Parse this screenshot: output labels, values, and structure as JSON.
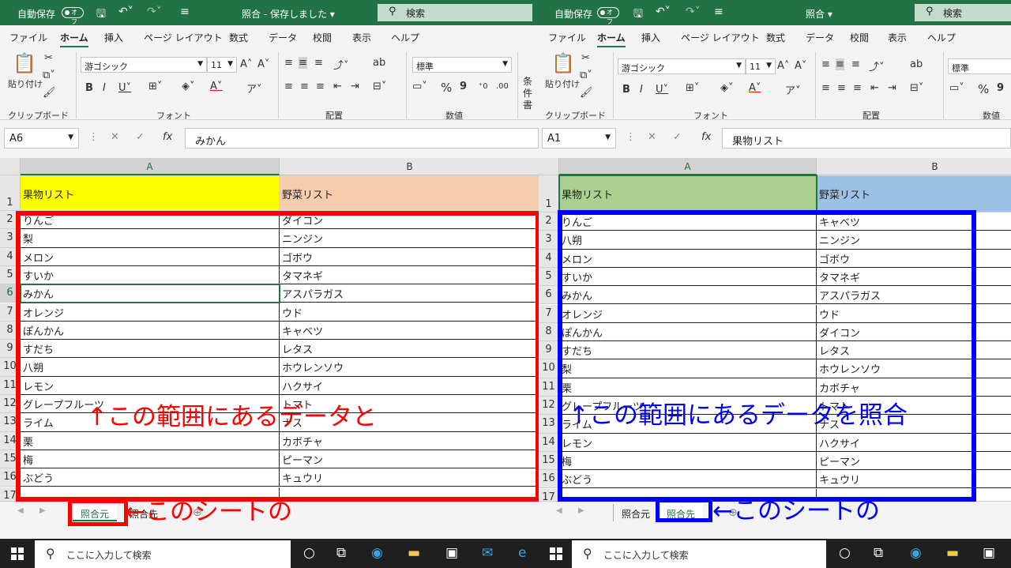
{
  "left": {
    "title": {
      "autosave": "自動保存",
      "toggle": "オフ",
      "doc": "照合 - 保存しました ▾",
      "search": "検索"
    },
    "menu": [
      "ファイル",
      "ホーム",
      "挿入",
      "ページ レイアウト",
      "数式",
      "データ",
      "校閲",
      "表示",
      "ヘルプ"
    ],
    "ribbon": {
      "paste_label": "貼り付け",
      "font_name": "游ゴシック",
      "font_size": "11",
      "number_format": "標準",
      "groups": {
        "clipboard": "クリップボード",
        "font": "フォント",
        "alignment": "配置",
        "number": "数値"
      },
      "cond_format": "条件\n書"
    },
    "name_box": "A6",
    "formula": "みかん",
    "columns": [
      "A",
      "B"
    ],
    "header_row": {
      "a": "果物リスト",
      "b": "野菜リスト"
    },
    "header_colors": {
      "a": "#ffff00",
      "b": "#f8cbad"
    },
    "rows": [
      {
        "n": "2",
        "a": "りんご",
        "b": "ダイコン"
      },
      {
        "n": "3",
        "a": "梨",
        "b": "ニンジン"
      },
      {
        "n": "4",
        "a": "メロン",
        "b": "ゴボウ"
      },
      {
        "n": "5",
        "a": "すいか",
        "b": "タマネギ"
      },
      {
        "n": "6",
        "a": "みかん",
        "b": "アスパラガス"
      },
      {
        "n": "7",
        "a": "オレンジ",
        "b": "ウド"
      },
      {
        "n": "8",
        "a": "ぽんかん",
        "b": "キャベツ"
      },
      {
        "n": "9",
        "a": "すだち",
        "b": "レタス"
      },
      {
        "n": "10",
        "a": "八朔",
        "b": "ホウレンソウ"
      },
      {
        "n": "11",
        "a": "レモン",
        "b": "ハクサイ"
      },
      {
        "n": "12",
        "a": "グレープフルーツ",
        "b": "トマト"
      },
      {
        "n": "13",
        "a": "ライム",
        "b": "ナス"
      },
      {
        "n": "14",
        "a": "栗",
        "b": "カボチャ"
      },
      {
        "n": "15",
        "a": "梅",
        "b": "ピーマン"
      },
      {
        "n": "16",
        "a": "ぶどう",
        "b": "キュウリ"
      },
      {
        "n": "17",
        "a": "",
        "b": ""
      }
    ],
    "tabs": [
      "照合元",
      "照合先"
    ],
    "annotation_range": "↑この範囲にあるデータと",
    "annotation_sheet": "このシートの",
    "annotation_color": "#ff0000"
  },
  "right": {
    "title": {
      "autosave": "自動保存",
      "toggle": "オフ",
      "doc": "照合 ▾",
      "search": "検索"
    },
    "menu": [
      "ファイル",
      "ホーム",
      "挿入",
      "ページ レイアウト",
      "数式",
      "データ",
      "校閲",
      "表示",
      "ヘルプ"
    ],
    "ribbon": {
      "paste_label": "貼り付け",
      "font_name": "游ゴシック",
      "font_size": "11",
      "number_format": "標準",
      "groups": {
        "clipboard": "クリップボード",
        "font": "フォント",
        "alignment": "配置",
        "number": "数値"
      }
    },
    "name_box": "A1",
    "formula": "果物リスト",
    "columns": [
      "A",
      "B"
    ],
    "header_row": {
      "a": "果物リスト",
      "b": "野菜リスト"
    },
    "header_colors": {
      "a": "#a9d08e",
      "b": "#9bc2e6"
    },
    "rows": [
      {
        "n": "2",
        "a": "りんご",
        "b": "キャベツ"
      },
      {
        "n": "3",
        "a": "八朔",
        "b": "ニンジン"
      },
      {
        "n": "4",
        "a": "メロン",
        "b": "ゴボウ"
      },
      {
        "n": "5",
        "a": "すいか",
        "b": "タマネギ"
      },
      {
        "n": "6",
        "a": "みかん",
        "b": "アスパラガス"
      },
      {
        "n": "7",
        "a": "オレンジ",
        "b": "ウド"
      },
      {
        "n": "8",
        "a": "ぽんかん",
        "b": "ダイコン"
      },
      {
        "n": "9",
        "a": "すだち",
        "b": "レタス"
      },
      {
        "n": "10",
        "a": "梨",
        "b": "ホウレンソウ"
      },
      {
        "n": "11",
        "a": "栗",
        "b": "カボチャ"
      },
      {
        "n": "12",
        "a": "グレープフルーツ",
        "b": "トマト"
      },
      {
        "n": "13",
        "a": "ライム",
        "b": "ナス"
      },
      {
        "n": "14",
        "a": "レモン",
        "b": "ハクサイ"
      },
      {
        "n": "15",
        "a": "梅",
        "b": "ピーマン"
      },
      {
        "n": "16",
        "a": "ぶどう",
        "b": "キュウリ"
      },
      {
        "n": "17",
        "a": "",
        "b": ""
      }
    ],
    "tabs": [
      "照合元",
      "照合先"
    ],
    "annotation_range": "↑この範囲にあるデータを照合",
    "annotation_sheet": "このシートの",
    "annotation_color": "#0000ff"
  },
  "taskbar": {
    "search_placeholder": "ここに入力して検索"
  }
}
